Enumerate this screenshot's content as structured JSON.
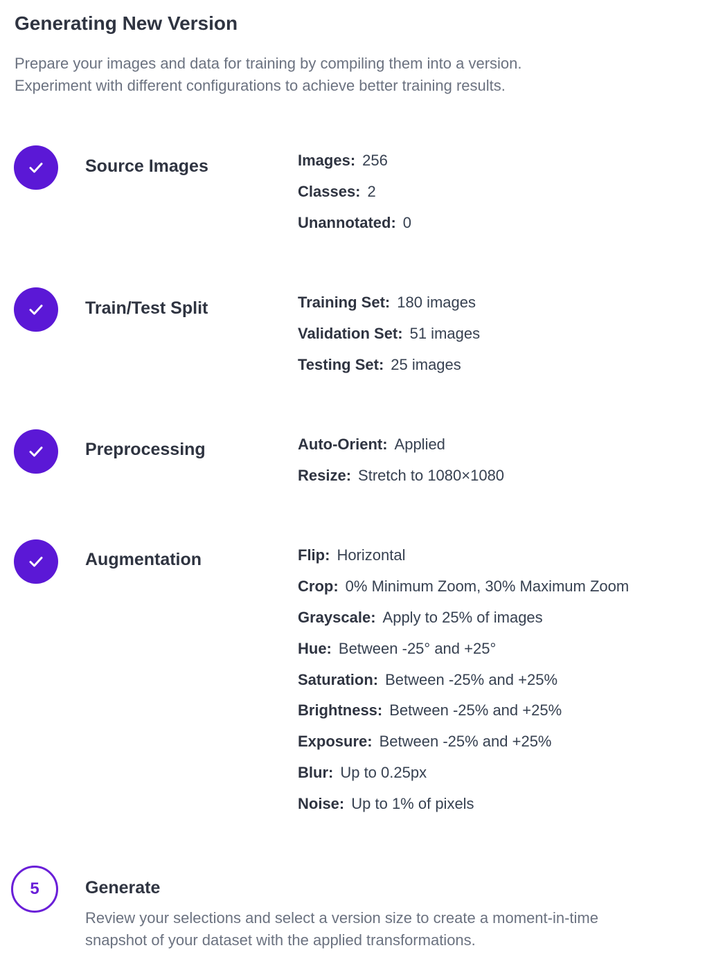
{
  "page": {
    "title": "Generating New Version",
    "intro_lines": [
      "Prepare your images and data for training by compiling them into a version.",
      "Experiment with different configurations to achieve better training results."
    ]
  },
  "colors": {
    "accent": "#5b18d6",
    "title_text": "#2f3441",
    "muted_text": "#6b7280"
  },
  "steps": [
    {
      "title": "Source Images",
      "status": "complete",
      "icon": "checkmark-icon",
      "details": [
        {
          "label": "Images:",
          "value": "256"
        },
        {
          "label": "Classes:",
          "value": "2"
        },
        {
          "label": "Unannotated:",
          "value": "0"
        }
      ]
    },
    {
      "title": "Train/Test Split",
      "status": "complete",
      "icon": "checkmark-icon",
      "details": [
        {
          "label": "Training Set:",
          "value": "180 images"
        },
        {
          "label": "Validation Set:",
          "value": "51 images"
        },
        {
          "label": "Testing Set:",
          "value": "25 images"
        }
      ]
    },
    {
      "title": "Preprocessing",
      "status": "complete",
      "icon": "checkmark-icon",
      "details": [
        {
          "label": "Auto-Orient:",
          "value": "Applied"
        },
        {
          "label": "Resize:",
          "value": "Stretch to 1080×1080"
        }
      ]
    },
    {
      "title": "Augmentation",
      "status": "complete",
      "icon": "checkmark-icon",
      "details": [
        {
          "label": "Flip:",
          "value": "Horizontal"
        },
        {
          "label": "Crop:",
          "value": "0% Minimum Zoom, 30% Maximum Zoom"
        },
        {
          "label": "Grayscale:",
          "value": "Apply to 25% of images"
        },
        {
          "label": "Hue:",
          "value": "Between -25° and +25°"
        },
        {
          "label": "Saturation:",
          "value": "Between -25% and +25%"
        },
        {
          "label": "Brightness:",
          "value": "Between -25% and +25%"
        },
        {
          "label": "Exposure:",
          "value": "Between -25% and +25%"
        },
        {
          "label": "Blur:",
          "value": "Up to 0.25px"
        },
        {
          "label": "Noise:",
          "value": "Up to 1% of pixels"
        }
      ]
    }
  ],
  "generate": {
    "number": "5",
    "title": "Generate",
    "status": "current",
    "description_lines": [
      "Review your selections and select a version size to create a moment-in-time",
      "snapshot of your dataset with the applied transformations."
    ]
  }
}
